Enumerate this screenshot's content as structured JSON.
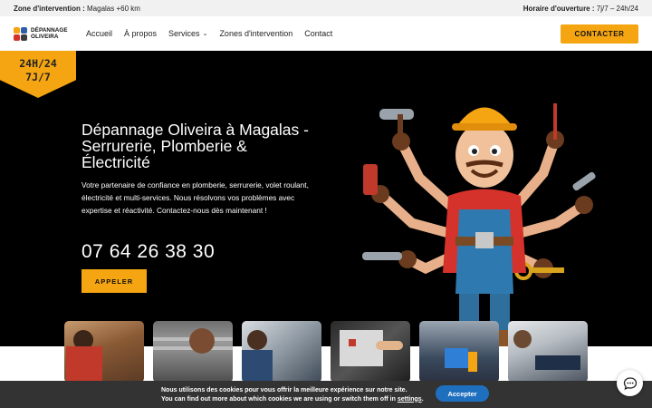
{
  "topbar": {
    "zone_label": "Zone d'intervention :",
    "zone_value": " Magalas +60 km",
    "hours_label": "Horaire d'ouverture :",
    "hours_value": " 7j/7 – 24h/24"
  },
  "header": {
    "logo_line1": "DÉPANNAGE",
    "logo_line2": "OLIVEIRA",
    "nav": [
      "Accueil",
      "À propos",
      "Services",
      "Zones d'intervention",
      "Contact"
    ],
    "cta_label": "CONTACTER"
  },
  "badge": {
    "line1": "24H/24",
    "line2": "7J/7"
  },
  "hero": {
    "title": "Dépannage Oliveira à Magalas - Serrurerie, Plomberie & Électricité",
    "text": "Votre partenaire de confiance en plomberie, serrurerie, volet roulant, électricité et multi-services. Nous résolvons vos problèmes avec expertise et réactivité. Contactez-nous dès maintenant !",
    "phone": "07 64 26 38 30",
    "call_label": "APPELER"
  },
  "cookie": {
    "line1": "Nous utilisons des cookies pour vous offrir la meilleure expérience sur notre site.",
    "line2_pre": "You can find out more about which cookies we are using or switch them off in ",
    "line2_link": "settings",
    "line2_post": ".",
    "accept_label": "Accepter"
  },
  "colors": {
    "accent": "#f5a512",
    "dark": "#000000",
    "cookie_bg": "#333333",
    "accept": "#1f6fbf"
  },
  "icons": {
    "chat": "chat-bubble-icon",
    "dropdown": "chevron-down-icon"
  }
}
